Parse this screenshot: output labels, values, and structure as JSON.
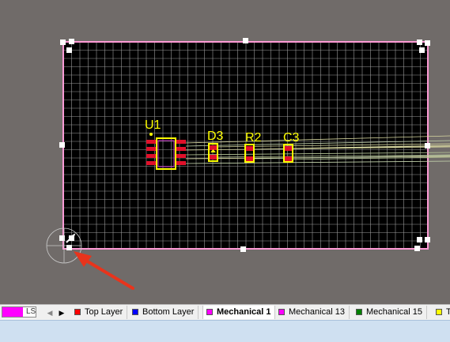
{
  "board": {
    "components": [
      {
        "designator": "U1"
      },
      {
        "designator": "D3"
      },
      {
        "designator": "R2"
      },
      {
        "designator": "C3"
      }
    ]
  },
  "layer_bar": {
    "current_layer_label": "LS",
    "current_layer_color": "#ff00ff",
    "prev_symbol": "◀",
    "next_symbol": "▶",
    "tabs": [
      {
        "label": "Top Layer",
        "color": "#ff0000"
      },
      {
        "label": "Bottom Layer",
        "color": "#0000ff"
      },
      {
        "label": "Mechanical 1",
        "color": "#ff00ff",
        "active": true
      },
      {
        "label": "Mechanical 13",
        "color": "#ff00ff"
      },
      {
        "label": "Mechanical 15",
        "color": "#008000"
      },
      {
        "label": "T",
        "color": "#ffff00"
      }
    ]
  },
  "colors": {
    "workspace": "#706b69",
    "board": "#000000",
    "grid": "#9a9a9a",
    "outline": "#ff9bd6",
    "silkscreen": "#ffff00",
    "pad": "#e0102a",
    "annotation_arrow": "#e8341c",
    "status_bar": "#cfe0f1"
  }
}
